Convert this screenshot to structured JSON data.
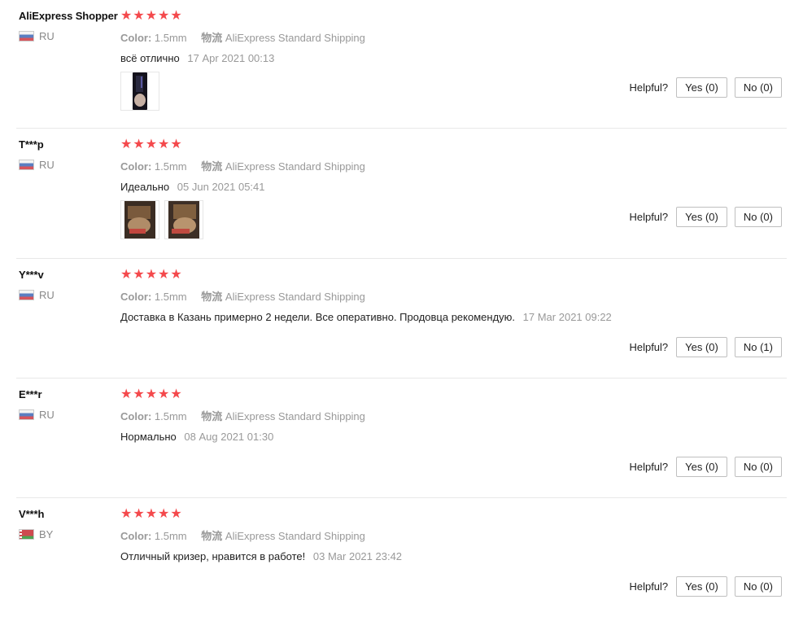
{
  "labels": {
    "color_key": "Color:",
    "shipping_key": "物流",
    "helpful": "Helpful?"
  },
  "reviews": [
    {
      "user": "AliExpress Shopper",
      "country": "RU",
      "flag": "ru",
      "stars": 5,
      "color": "1.5mm",
      "shipping": "AliExpress Standard Shipping",
      "text": "всё отлично",
      "date": "17 Apr 2021 00:13",
      "photos": 1,
      "yes": "Yes (0)",
      "no": "No (0)"
    },
    {
      "user": "T***p",
      "country": "RU",
      "flag": "ru",
      "stars": 5,
      "color": "1.5mm",
      "shipping": "AliExpress Standard Shipping",
      "text": "Идеально",
      "date": "05 Jun 2021 05:41",
      "photos": 2,
      "yes": "Yes (0)",
      "no": "No (0)"
    },
    {
      "user": "Y***v",
      "country": "RU",
      "flag": "ru",
      "stars": 5,
      "color": "1.5mm",
      "shipping": "AliExpress Standard Shipping",
      "text": "Доставка в Казань примерно 2 недели. Все оперативно. Продовца рекомендую.",
      "date": "17 Mar 2021 09:22",
      "photos": 0,
      "yes": "Yes (0)",
      "no": "No (1)"
    },
    {
      "user": "E***r",
      "country": "RU",
      "flag": "ru",
      "stars": 5,
      "color": "1.5mm",
      "shipping": "AliExpress Standard Shipping",
      "text": "Нормально",
      "date": "08 Aug 2021 01:30",
      "photos": 0,
      "yes": "Yes (0)",
      "no": "No (0)"
    },
    {
      "user": "V***h",
      "country": "BY",
      "flag": "by",
      "stars": 5,
      "color": "1.5mm",
      "shipping": "AliExpress Standard Shipping",
      "text": "Отличный кризер, нравится в работе!",
      "date": "03 Mar 2021 23:42",
      "photos": 0,
      "yes": "Yes (0)",
      "no": "No (0)"
    }
  ],
  "colors": {
    "star": "#f4494c",
    "muted_text": "#999999",
    "divider": "#e8e8e8"
  },
  "icons": {
    "star": "star-icon",
    "flag_ru": "flag-ru-icon",
    "flag_by": "flag-by-icon"
  }
}
